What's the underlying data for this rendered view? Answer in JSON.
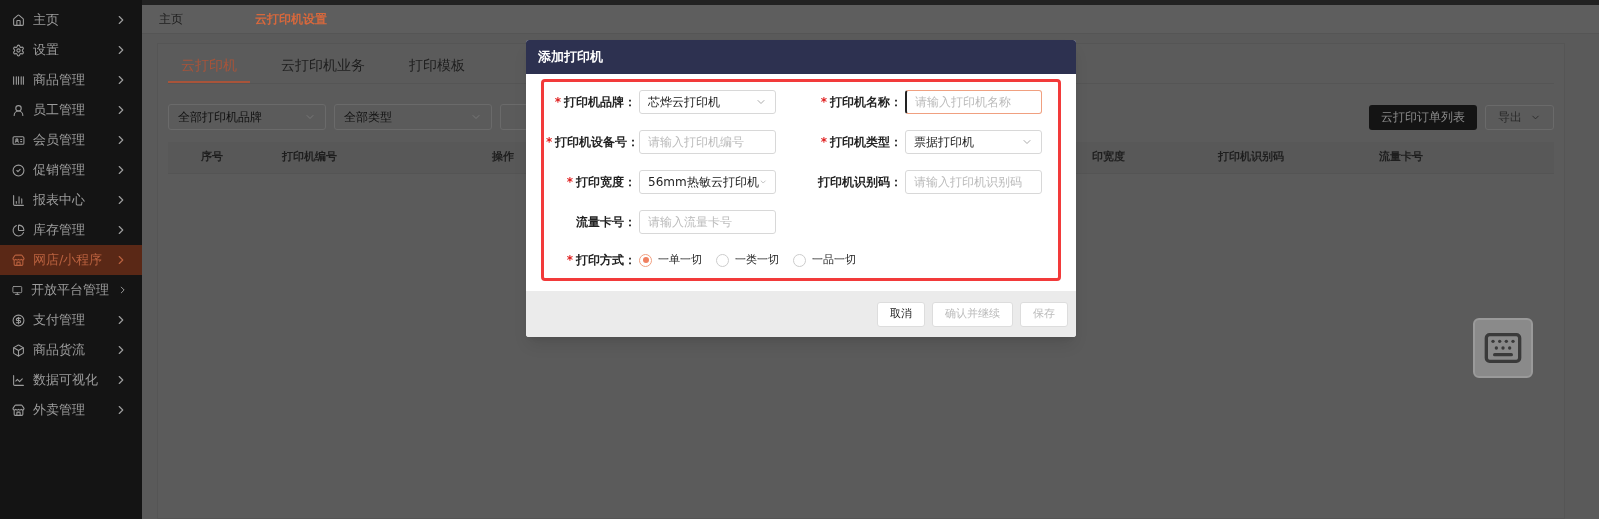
{
  "sidebar": {
    "items": [
      {
        "label": "主页",
        "selected": false
      },
      {
        "label": "设置",
        "selected": false
      },
      {
        "label": "商品管理",
        "selected": false
      },
      {
        "label": "员工管理",
        "selected": false
      },
      {
        "label": "会员管理",
        "selected": false
      },
      {
        "label": "促销管理",
        "selected": false
      },
      {
        "label": "报表中心",
        "selected": false
      },
      {
        "label": "库存管理",
        "selected": false
      },
      {
        "label": "网店/小程序",
        "selected": true
      },
      {
        "label": "开放平台管理",
        "selected": false
      },
      {
        "label": "支付管理",
        "selected": false
      },
      {
        "label": "商品货流",
        "selected": false
      },
      {
        "label": "数据可视化",
        "selected": false
      },
      {
        "label": "外卖管理",
        "selected": false
      }
    ]
  },
  "breadcrumb": [
    {
      "label": "主页",
      "selected": false
    },
    {
      "label": "云打印机设置",
      "selected": true
    }
  ],
  "tabs": [
    {
      "label": "云打印机",
      "selected": true
    },
    {
      "label": "云打印机业务",
      "selected": false
    },
    {
      "label": "打印模板",
      "selected": false
    }
  ],
  "filters": [
    {
      "kind": "select",
      "value": "全部打印机品牌"
    },
    {
      "kind": "select",
      "value": "全部类型"
    },
    {
      "kind": "input"
    }
  ],
  "actions": [
    {
      "kind": "primary",
      "label": "云打印订单列表"
    },
    {
      "kind": "dropdown",
      "label": "导出"
    }
  ],
  "table": {
    "columns_left": [
      "序号",
      "打印机编号",
      "操作"
    ],
    "columns_right": [
      "印宽度",
      "打印机识别码",
      "流量卡号"
    ]
  },
  "dialog": {
    "title": "添加打印机",
    "fields": [
      {
        "label": "打印机品牌：",
        "required_mark": "*",
        "kind": "select",
        "value": "芯烨云打印机"
      },
      {
        "label": "打印机名称：",
        "required_mark": "*",
        "kind": "input",
        "placeholder": "请输入打印机名称",
        "focused": true
      },
      {
        "label": "打印机设备号：",
        "required_mark": "*",
        "kind": "input",
        "placeholder": "请输入打印机编号",
        "focused": false
      },
      {
        "label": "打印机类型：",
        "required_mark": "*",
        "kind": "select",
        "value": "票据打印机"
      },
      {
        "label": "打印宽度：",
        "required_mark": "*",
        "kind": "select",
        "value": "56mm热敏云打印机"
      },
      {
        "label": "打印机识别码：",
        "kind": "input",
        "placeholder": "请输入打印机识别码",
        "focused": false
      },
      {
        "label": "流量卡号：",
        "kind": "input",
        "placeholder": "请输入流量卡号",
        "focused": false
      }
    ],
    "print_mode": {
      "label": "打印方式：",
      "required_mark": "*",
      "options": [
        {
          "label": "一单一切",
          "selected": true
        },
        {
          "label": "一类一切",
          "selected": false
        },
        {
          "label": "一品一切",
          "selected": false
        }
      ]
    },
    "buttons": [
      {
        "label": "取消",
        "disabled": false
      },
      {
        "label": "确认并继续",
        "disabled": true
      },
      {
        "label": "保存",
        "disabled": true
      }
    ]
  }
}
